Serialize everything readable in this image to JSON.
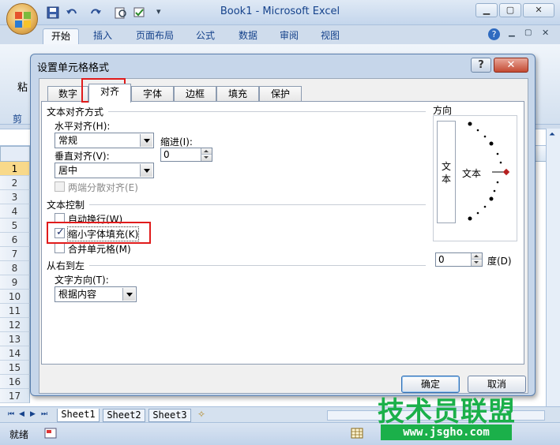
{
  "window": {
    "title": "Book1 - Microsoft Excel",
    "ribbon_tabs": [
      "开始",
      "插入",
      "页面布局",
      "公式",
      "数据",
      "审阅",
      "视图"
    ],
    "ribbon_group_partial": [
      "粘",
      "剪"
    ]
  },
  "sheet": {
    "row_numbers": [
      "1",
      "2",
      "3",
      "4",
      "5",
      "6",
      "7",
      "8",
      "9",
      "10",
      "11",
      "12",
      "13",
      "14",
      "15",
      "16",
      "17"
    ],
    "tabs": [
      "Sheet1",
      "Sheet2",
      "Sheet3"
    ],
    "status": "就绪"
  },
  "dialog": {
    "title": "设置单元格格式",
    "help_label": "?",
    "close_label": "✕",
    "tabs": [
      "数字",
      "对齐",
      "字体",
      "边框",
      "填充",
      "保护"
    ],
    "alignment": {
      "section_title": "文本对齐方式",
      "horizontal_label": "水平对齐(H):",
      "horizontal_value": "常规",
      "indent_label": "缩进(I):",
      "indent_value": "0",
      "vertical_label": "垂直对齐(V):",
      "vertical_value": "居中",
      "distributed_label": "两端分散对齐(E)"
    },
    "control": {
      "section_title": "文本控制",
      "wrap_label": "自动换行(W)",
      "shrink_label": "缩小字体填充(K)",
      "merge_label": "合并单元格(M)"
    },
    "rtl": {
      "section_title": "从右到左",
      "direction_label": "文字方向(T):",
      "direction_value": "根据内容"
    },
    "orientation": {
      "section_title": "方向",
      "vertical_text": [
        "文",
        "本"
      ],
      "dial_text": "文本",
      "degree_value": "0",
      "degree_label": "度(D)"
    },
    "ok_label": "确定",
    "cancel_label": "取消"
  },
  "watermark": {
    "line1": "技术员联盟",
    "line2": "www.jsgho.com"
  }
}
